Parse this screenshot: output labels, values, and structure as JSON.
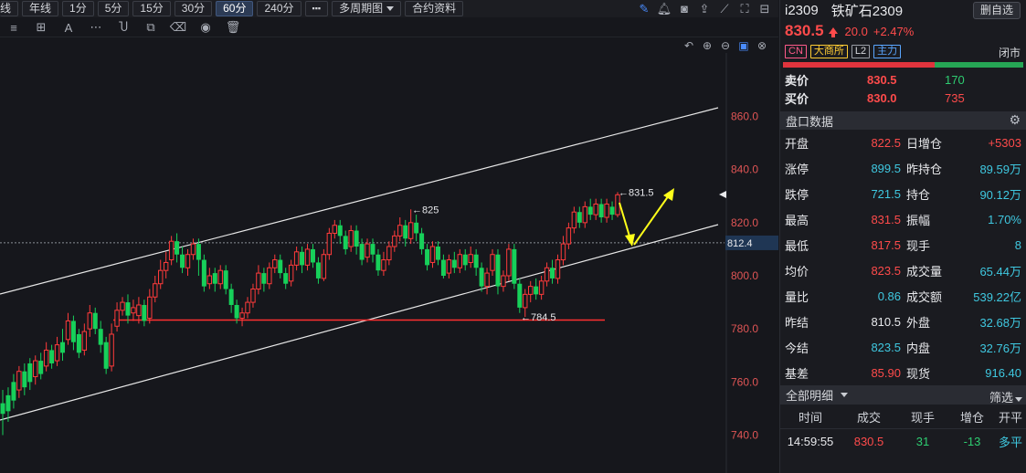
{
  "toolbar": {
    "periods": [
      {
        "label": "线",
        "active": false
      },
      {
        "label": "年线",
        "active": false
      },
      {
        "label": "1分",
        "active": false
      },
      {
        "label": "5分",
        "active": false
      },
      {
        "label": "15分",
        "active": false
      },
      {
        "label": "30分",
        "active": false
      },
      {
        "label": "60分",
        "active": true
      },
      {
        "label": "240分",
        "active": false
      }
    ],
    "more_label": "▪▪▪",
    "multi_period_label": "多周期图",
    "contract_info_label": "合约资料"
  },
  "chart": {
    "price_labels": [
      "860.0",
      "840.0",
      "820.0",
      "800.0",
      "780.0",
      "760.0",
      "740.0"
    ],
    "current_line_label": "812.4",
    "annotations": {
      "high_825": "←825",
      "high_831": "←831.5",
      "low_784": "←784.5"
    },
    "colors": {
      "up": "#ff3b3b",
      "down": "#17d05a",
      "support": "#ff3030",
      "arrow": "#ffff1a",
      "channel": "#e8e8e8"
    }
  },
  "quote": {
    "code": "i2309",
    "name": "铁矿石2309",
    "remove_label": "删自选",
    "last": "830.5",
    "change": "20.0",
    "change_pct": "+2.47%",
    "tags": [
      "CN",
      "大商所",
      "L2",
      "主力"
    ],
    "status": "闭市",
    "orderbook": [
      {
        "label": "卖价",
        "price": "830.5",
        "vol": "170"
      },
      {
        "label": "买价",
        "price": "830.0",
        "vol": "735"
      }
    ],
    "panel_title": "盘口数据",
    "data": [
      {
        "l1": "开盘",
        "v1": "822.5",
        "c1": "red",
        "l2": "日增仓",
        "v2": "+5303",
        "c2": "red"
      },
      {
        "l1": "涨停",
        "v1": "899.5",
        "c1": "cyan",
        "l2": "昨持仓",
        "v2": "89.59万",
        "c2": "cyan"
      },
      {
        "l1": "跌停",
        "v1": "721.5",
        "c1": "cyan",
        "l2": "持仓",
        "v2": "90.12万",
        "c2": "cyan"
      },
      {
        "l1": "最高",
        "v1": "831.5",
        "c1": "red",
        "l2": "振幅",
        "v2": "1.70%",
        "c2": "cyan"
      },
      {
        "l1": "最低",
        "v1": "817.5",
        "c1": "red",
        "l2": "现手",
        "v2": "8",
        "c2": "cyan"
      },
      {
        "l1": "均价",
        "v1": "823.5",
        "c1": "red",
        "l2": "成交量",
        "v2": "65.44万",
        "c2": "cyan"
      },
      {
        "l1": "量比",
        "v1": "0.86",
        "c1": "cyan",
        "l2": "成交额",
        "v2": "539.22亿",
        "c2": "cyan"
      },
      {
        "l1": "昨结",
        "v1": "810.5",
        "c1": "white",
        "l2": "外盘",
        "v2": "32.68万",
        "c2": "cyan"
      },
      {
        "l1": "今结",
        "v1": "823.5",
        "c1": "cyan",
        "l2": "内盘",
        "v2": "32.76万",
        "c2": "cyan"
      },
      {
        "l1": "基差",
        "v1": "85.90",
        "c1": "red",
        "l2": "现货",
        "v2": "916.40",
        "c2": "cyan"
      }
    ],
    "trades_title": "全部明细",
    "filter_label": "筛选",
    "trade_cols": [
      "时间",
      "成交",
      "现手",
      "增仓",
      "开平"
    ],
    "trades": [
      {
        "time": "14:59:55",
        "price": "830.5",
        "vol": "31",
        "oi": "-13",
        "oc": "多平"
      }
    ]
  }
}
